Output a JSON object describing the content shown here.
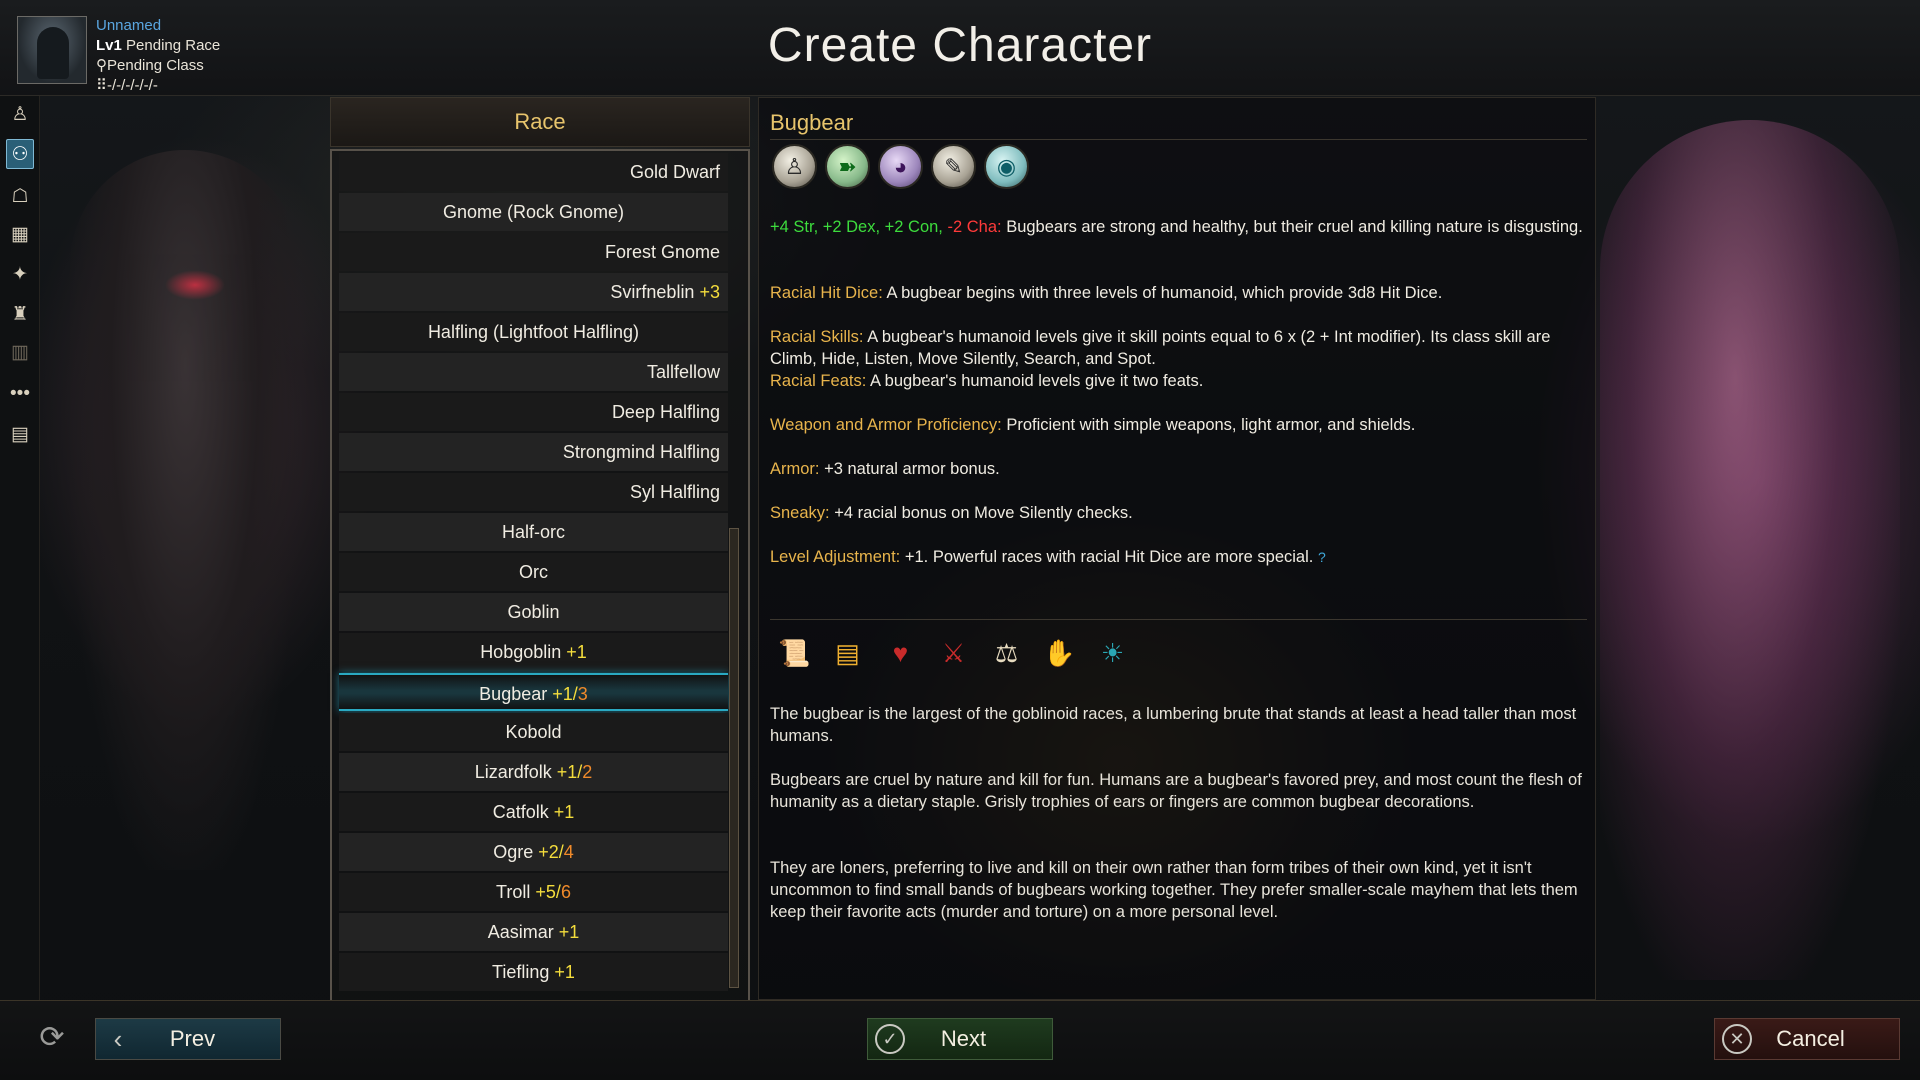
{
  "header": {
    "title": "Create Character",
    "character": {
      "name": "Unnamed",
      "level": "Lv1",
      "race": "Pending Race",
      "class": "Pending Class",
      "stats": "-/-/-/-/-/-"
    }
  },
  "sidebar": {
    "items": [
      {
        "icon": "person-icon",
        "glyph": "♙"
      },
      {
        "icon": "race-icon",
        "glyph": "⚇"
      },
      {
        "icon": "class-book-icon",
        "glyph": "☖"
      },
      {
        "icon": "abilities-grid-icon",
        "glyph": "▦"
      },
      {
        "icon": "skills-icon",
        "glyph": "✦"
      },
      {
        "icon": "feats-icon",
        "glyph": "♜"
      },
      {
        "icon": "spellbook-icon",
        "glyph": "▥"
      },
      {
        "icon": "more-icon",
        "glyph": "•••"
      },
      {
        "icon": "summary-card-icon",
        "glyph": "▤"
      }
    ]
  },
  "race_panel": {
    "title": "Race",
    "rows": [
      {
        "name": "Gold Dwarf",
        "align": "right"
      },
      {
        "name": "Gnome (Rock Gnome)",
        "align": "center"
      },
      {
        "name": "Forest Gnome",
        "align": "right"
      },
      {
        "name": "Svirfneblin",
        "align": "right",
        "adj1": "+3"
      },
      {
        "name": "Halfling (Lightfoot Halfling)",
        "align": "center"
      },
      {
        "name": "Tallfellow",
        "align": "right"
      },
      {
        "name": "Deep Halfling",
        "align": "right"
      },
      {
        "name": "Strongmind Halfling",
        "align": "right"
      },
      {
        "name": "Syl Halfling",
        "align": "right"
      },
      {
        "name": "Half-orc",
        "align": "center"
      },
      {
        "name": "Orc",
        "align": "center"
      },
      {
        "name": "Goblin",
        "align": "center"
      },
      {
        "name": "Hobgoblin",
        "align": "center",
        "adj1": "+1"
      },
      {
        "name": "Bugbear",
        "align": "center",
        "adj1": "+1",
        "adj2": "3",
        "selected": true
      },
      {
        "name": "Kobold",
        "align": "center"
      },
      {
        "name": "Lizardfolk",
        "align": "center",
        "adj1": "+1",
        "adj2": "2"
      },
      {
        "name": "Catfolk",
        "align": "center",
        "adj1": "+1"
      },
      {
        "name": "Ogre",
        "align": "center",
        "adj1": "+2",
        "adj2": "4"
      },
      {
        "name": "Troll",
        "align": "center",
        "adj1": "+5",
        "adj2": "6"
      },
      {
        "name": "Aasimar",
        "align": "center",
        "adj1": "+1"
      },
      {
        "name": "Tiefling",
        "align": "center",
        "adj1": "+1"
      }
    ]
  },
  "info": {
    "title": "Bugbear",
    "trait_icons": [
      {
        "name": "humanoid-icon",
        "glyph": "♙",
        "style": ""
      },
      {
        "name": "running-icon",
        "glyph": "➽",
        "style": "green"
      },
      {
        "name": "hooded-rogue-icon",
        "glyph": "◕",
        "style": "purple"
      },
      {
        "name": "scroll-quill-icon",
        "glyph": "✎",
        "style": ""
      },
      {
        "name": "eye-icon",
        "glyph": "◉",
        "style": "teal"
      }
    ],
    "ability_mods": {
      "green": "+4 Str, +2 Dex, +2 Con,",
      "red": "-2 Cha:",
      "text": " Bugbears are strong and healthy, but their cruel and killing nature is disgusting."
    },
    "traits": [
      {
        "label": "Racial Hit Dice:",
        "text": " A bugbear begins with three levels of humanoid, which provide 3d8 Hit Dice."
      },
      {
        "label": "Racial Skills:",
        "text": " A bugbear's humanoid levels give it skill points equal to 6 x (2 + Int modifier). Its class skill are Climb, Hide, Listen, Move Silently, Search, and Spot."
      },
      {
        "label": "Racial Feats:",
        "text": " A bugbear's humanoid levels give it two feats."
      },
      {
        "label": "Weapon and Armor Proficiency:",
        "text": " Proficient with simple weapons, light armor, and shields."
      },
      {
        "label": "Armor:",
        "text": " +3 natural armor bonus."
      },
      {
        "label": "Sneaky:",
        "text": " +4 racial bonus on Move Silently checks."
      },
      {
        "label": "Level Adjustment:",
        "text": " +1. Powerful races with racial Hit Dice are more special."
      }
    ],
    "level_adjustment_help": "?",
    "feature_icons": [
      {
        "name": "scroll-icon",
        "glyph": "📜",
        "style": ""
      },
      {
        "name": "gold-scroll-icon",
        "glyph": "▤",
        "style": "gold"
      },
      {
        "name": "figure-heart-icon",
        "glyph": "♥",
        "style": "red"
      },
      {
        "name": "crossed-swords-icon",
        "glyph": "⚔",
        "style": "red"
      },
      {
        "name": "crowd-balance-icon",
        "glyph": "⚖",
        "style": ""
      },
      {
        "name": "handshake-icon",
        "glyph": "✋",
        "style": ""
      },
      {
        "name": "deity-icon",
        "glyph": "☀",
        "style": "teal"
      }
    ],
    "lore": [
      "The bugbear is the largest of the goblinoid races, a lumbering brute that stands at least a head taller than most humans.",
      "Bugbears are cruel by nature and kill for fun. Humans are a bugbear's favored prey, and most count the flesh of humanity as a dietary staple. Grisly trophies of ears or fingers are common bugbear decorations.",
      "They are loners, preferring to live and kill on their own rather than form tribes of their own kind, yet it isn't uncommon to find small bands of bugbears working together. They prefer smaller-scale mayhem that lets them keep their favorite acts (murder and torture) on a more personal level."
    ]
  },
  "footer": {
    "prev_label": "Prev",
    "next_label": "Next",
    "cancel_label": "Cancel"
  }
}
